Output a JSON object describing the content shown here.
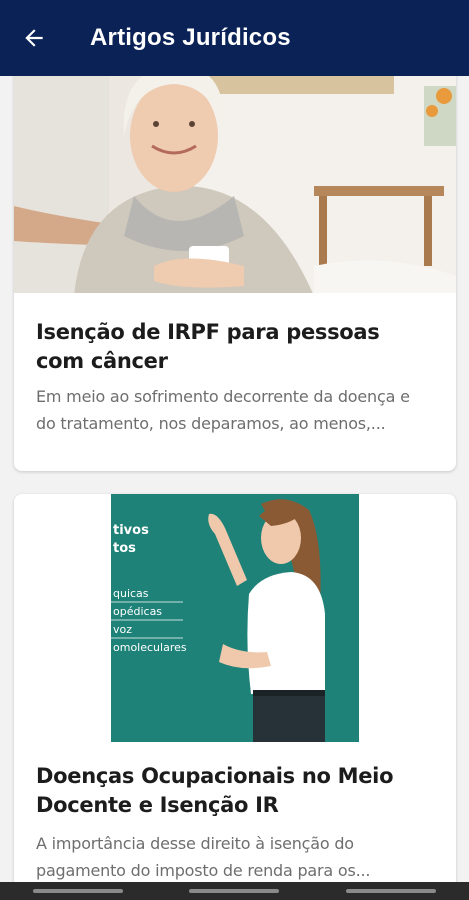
{
  "appbar": {
    "title": "Artigos Jurídicos",
    "back_icon": "arrow-left-icon",
    "background_color": "#0b2257"
  },
  "articles": [
    {
      "title": "Isenção de IRPF para pessoas com câncer",
      "excerpt": "Em meio ao sofrimento decorrente da doença e do tratamento, nos deparamos, ao menos,...",
      "image": "woman-with-headscarf-holding-mug"
    },
    {
      "title": "Doenças Ocupacionais no Meio Docente e Isenção IR",
      "excerpt": "A importância desse direito à isenção do pagamento do imposto de renda para os...",
      "image": "teacher-writing-on-chalkboard",
      "image_text": {
        "heading_1": "tivos",
        "heading_2": "tos",
        "items": [
          "quicas",
          "opédicas",
          "voz",
          "omoleculares"
        ]
      }
    }
  ]
}
